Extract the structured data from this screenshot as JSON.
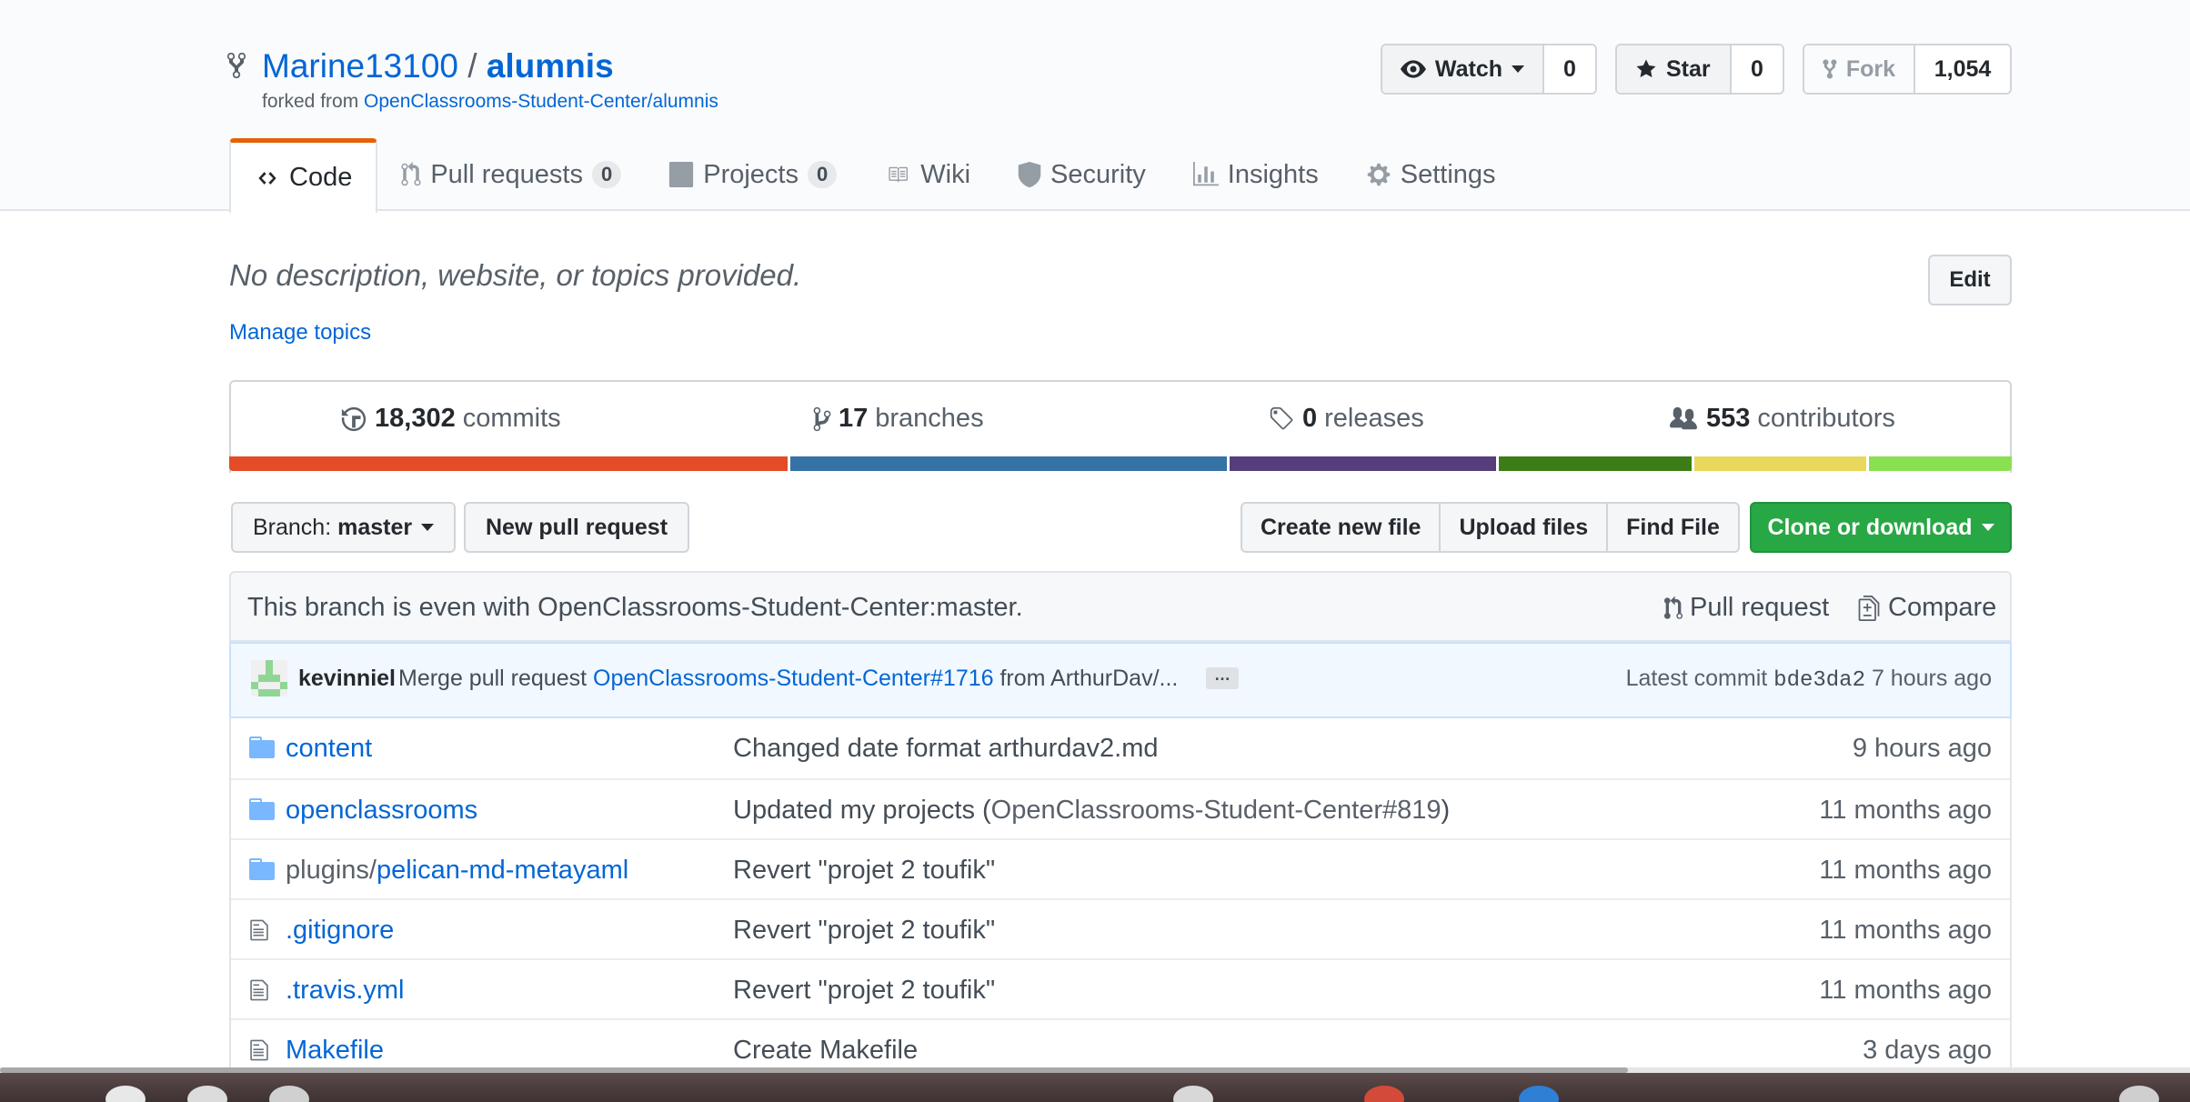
{
  "repo": {
    "owner": "Marine13100",
    "separator": " / ",
    "name": "alumnis",
    "forked_from_prefix": "forked from ",
    "forked_from": "OpenClassrooms-Student-Center/alumnis"
  },
  "actions": {
    "watch_label": "Watch",
    "watch_count": "0",
    "star_label": "Star",
    "star_count": "0",
    "fork_label": "Fork",
    "fork_count": "1,054"
  },
  "tabs": [
    {
      "label": "Code",
      "icon": "code-icon"
    },
    {
      "label": "Pull requests",
      "count": "0",
      "icon": "pull-request-icon"
    },
    {
      "label": "Projects",
      "count": "0",
      "icon": "project-icon"
    },
    {
      "label": "Wiki",
      "icon": "book-icon"
    },
    {
      "label": "Security",
      "icon": "shield-icon"
    },
    {
      "label": "Insights",
      "icon": "graph-icon"
    },
    {
      "label": "Settings",
      "icon": "gear-icon"
    }
  ],
  "description": {
    "text": "No description, website, or topics provided.",
    "manage_topics": "Manage topics",
    "edit_label": "Edit"
  },
  "summary": {
    "commits_count": "18,302",
    "commits_label": "commits",
    "branches_count": "17",
    "branches_label": "branches",
    "releases_count": "0",
    "releases_label": "releases",
    "contributors_count": "553",
    "contributors_label": "contributors"
  },
  "language_bar": [
    {
      "color": "#e34c26",
      "share": 0.315
    },
    {
      "color": "#3572a5",
      "share": 0.246
    },
    {
      "color": "#563d7c",
      "share": 0.151
    },
    {
      "color": "#3d7d18",
      "share": 0.11
    },
    {
      "color": "#e9d85c",
      "share": 0.098
    },
    {
      "color": "#89e051",
      "share": 0.08
    }
  ],
  "file_nav": {
    "branch_prefix": "Branch: ",
    "branch_name": "master",
    "new_pr": "New pull request",
    "create_file": "Create new file",
    "upload_files": "Upload files",
    "find_file": "Find File",
    "clone": "Clone or download"
  },
  "branch_status": {
    "message": "This branch is even with OpenClassrooms-Student-Center:master.",
    "pull_request": "Pull request",
    "compare": "Compare"
  },
  "latest_commit": {
    "author": "kevinniel",
    "message_prefix": "Merge pull request ",
    "message_link": "OpenClassrooms-Student-Center#1716",
    "message_suffix": " from ArthurDav/...",
    "ellipsis": "…",
    "latest_label": "Latest commit ",
    "sha": "bde3da2",
    "age": " 7 hours ago"
  },
  "files": [
    {
      "type": "dir",
      "prefix": "",
      "name": "content",
      "message": "Changed date format arthurdav2.md",
      "message_ref": "",
      "message_end": "",
      "age": "9 hours ago"
    },
    {
      "type": "dir",
      "prefix": "",
      "name": "openclassrooms",
      "message": "Updated my projects (",
      "message_ref": "OpenClassrooms-Student-Center#819",
      "message_end": ")",
      "age": "11 months ago"
    },
    {
      "type": "dir",
      "prefix": "plugins/",
      "name": "pelican-md-metayaml",
      "message": "Revert \"projet 2 toufik\"",
      "message_ref": "",
      "message_end": "",
      "age": "11 months ago"
    },
    {
      "type": "file",
      "prefix": "",
      "name": ".gitignore",
      "message": "Revert \"projet 2 toufik\"",
      "message_ref": "",
      "message_end": "",
      "age": "11 months ago"
    },
    {
      "type": "file",
      "prefix": "",
      "name": ".travis.yml",
      "message": "Revert \"projet 2 toufik\"",
      "message_ref": "",
      "message_end": "",
      "age": "11 months ago"
    },
    {
      "type": "file",
      "prefix": "",
      "name": "Makefile",
      "message": "Create Makefile",
      "message_ref": "",
      "message_end": "",
      "age": "3 days ago"
    }
  ]
}
